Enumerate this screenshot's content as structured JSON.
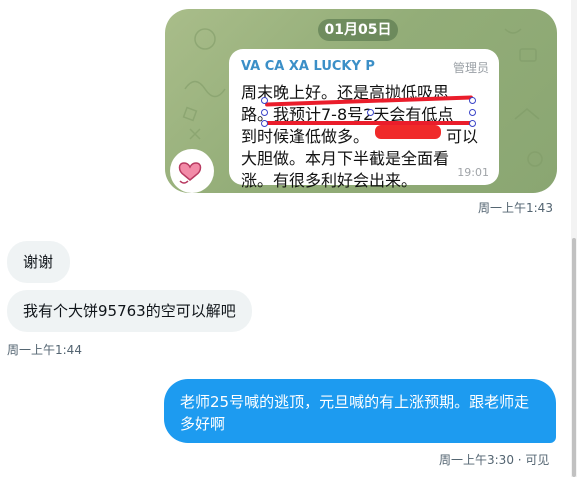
{
  "image_message": {
    "date": "01月05日",
    "sender": "VA CA XA LUCKY P",
    "role": "管理员",
    "lines": [
      "周末晚上好。还是高抛低吸思",
      "路。我预计7-8号2天会有低点",
      "到时候逢低做多。",
      "大胆做。本月下半截是全面看",
      "涨。有很多利好会出来。"
    ],
    "line3_tail": "可以",
    "time": "19:01",
    "highlight_color": "#ea1d2b",
    "wallpaper_color": "#93ad78",
    "avatar_icon": "heart-sticker-icon"
  },
  "messages": [
    {
      "text": "",
      "time": "周一上午1:43"
    },
    {
      "text": "谢谢",
      "time": ""
    },
    {
      "text": "我有个大饼95763的空可以解吧",
      "time": "周一上午1:44"
    },
    {
      "text": "老师25号喊的逃顶，元旦喊的有上涨预期。跟老师走多好啊",
      "time": "周一上午3:30 · 可见"
    }
  ],
  "colors": {
    "outgoing": "#1d9bf0",
    "incoming": "#eff3f4",
    "timestamp": "#536471"
  }
}
